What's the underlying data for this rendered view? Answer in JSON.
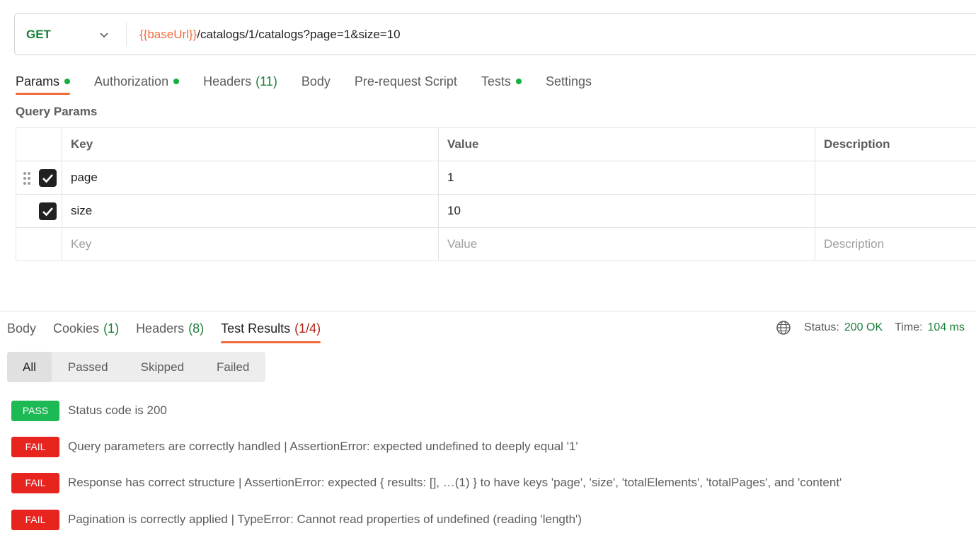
{
  "request": {
    "method": "GET",
    "url_variable": "{{baseUrl}}",
    "url_path": "/catalogs/1/catalogs?page=1&size=10"
  },
  "request_tabs": [
    {
      "label": "Params",
      "dot": true,
      "count": "",
      "active": true
    },
    {
      "label": "Authorization",
      "dot": true,
      "count": "",
      "active": false
    },
    {
      "label": "Headers",
      "dot": false,
      "count": "(11)",
      "active": false
    },
    {
      "label": "Body",
      "dot": false,
      "count": "",
      "active": false
    },
    {
      "label": "Pre-request Script",
      "dot": false,
      "count": "",
      "active": false
    },
    {
      "label": "Tests",
      "dot": true,
      "count": "",
      "active": false
    },
    {
      "label": "Settings",
      "dot": false,
      "count": "",
      "active": false
    }
  ],
  "query_params": {
    "title": "Query Params",
    "headers": {
      "key": "Key",
      "value": "Value",
      "description": "Description"
    },
    "rows": [
      {
        "key": "page",
        "value": "1",
        "description": "",
        "checked": true
      },
      {
        "key": "size",
        "value": "10",
        "description": "",
        "checked": true
      }
    ],
    "placeholders": {
      "key": "Key",
      "value": "Value",
      "description": "Description"
    }
  },
  "response_tabs": [
    {
      "label": "Body",
      "count": "",
      "active": false
    },
    {
      "label": "Cookies",
      "count": "(1)",
      "active": false
    },
    {
      "label": "Headers",
      "count": "(8)",
      "active": false
    },
    {
      "label": "Test Results",
      "count": "(1/4)",
      "active": true
    }
  ],
  "status": {
    "status_label": "Status:",
    "status_value": "200 OK",
    "time_label": "Time:",
    "time_value": "104 ms"
  },
  "filters": [
    "All",
    "Passed",
    "Skipped",
    "Failed"
  ],
  "active_filter": "All",
  "results": [
    {
      "status": "PASS",
      "text": "Status code is 200"
    },
    {
      "status": "FAIL",
      "text": "Query parameters are correctly handled | AssertionError: expected undefined to deeply equal '1'"
    },
    {
      "status": "FAIL",
      "text": "Response has correct structure | AssertionError: expected { results: [], …(1) } to have keys 'page', 'size', 'totalElements', 'totalPages', and 'content'"
    },
    {
      "status": "FAIL",
      "text": "Pagination is correctly applied | TypeError: Cannot read properties of undefined (reading 'length')"
    }
  ],
  "colors": {
    "accent": "#f26b3a",
    "pass": "#1db954",
    "fail": "#e8241e",
    "success_text": "#1a7f37"
  }
}
